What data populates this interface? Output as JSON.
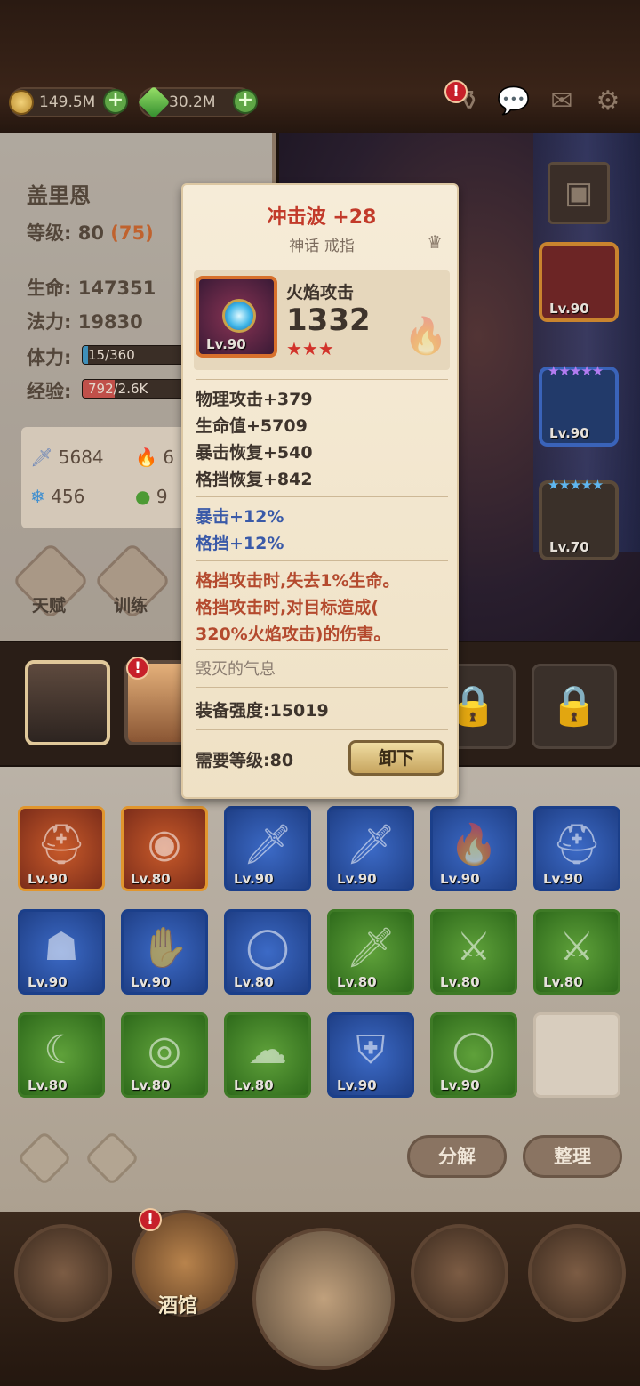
{
  "top": {
    "gold": "149.5M",
    "gems": "30.2M",
    "alert_mark": "!"
  },
  "hero": {
    "name": "盖里恩",
    "level_label": "等级:",
    "level": "80",
    "level_extra": "(75)",
    "hp_label": "生命:",
    "hp": "147351",
    "mp_label": "法力:",
    "mp": "19830",
    "stamina_label": "体力:",
    "stamina": "15/360",
    "stamina_fraction": 0.042,
    "exp_label": "经验:",
    "exp": "792/2.6K",
    "exp_fraction": 0.3,
    "attack": "5684",
    "attack_partial": "6",
    "defense": "456",
    "defense_partial": "9",
    "btn_talent": "天赋",
    "btn_train": "训练"
  },
  "scene_slots": [
    {
      "level": "Lv.90"
    },
    {
      "level": "Lv.90"
    },
    {
      "level": "Lv.70"
    }
  ],
  "tooltip": {
    "title": "冲击波 +28",
    "subtitle": "神话 戒指",
    "attr_name": "火焰攻击",
    "attr_value": "1332",
    "item_level": "Lv.90",
    "stars": "★★★",
    "stats": [
      "物理攻击+379",
      "生命值+5709",
      "暴击恢复+540",
      "格挡恢复+842"
    ],
    "bonuses": [
      "暴击+12%",
      "格挡+12%"
    ],
    "effect": [
      "格挡攻击时,失去1%生命。",
      "格挡攻击时,对目标造成(",
      "320%火焰攻击)的伤害。"
    ],
    "set_name": "毁灭的气息",
    "power_label": "装备强度:",
    "power": "15019",
    "req_label": "需要等级:",
    "req_level": "80",
    "unequip_label": "卸下"
  },
  "inventory": [
    [
      {
        "lv": "Lv.90",
        "type": "gold",
        "icon": "helmet-icon"
      },
      {
        "lv": "Lv.80",
        "type": "gold",
        "icon": "amulet-icon"
      },
      {
        "lv": "Lv.90",
        "type": "blue",
        "icon": "sword-icon"
      },
      {
        "lv": "Lv.90",
        "type": "blue",
        "icon": "dagger-icon"
      },
      {
        "lv": "Lv.90",
        "type": "blue",
        "icon": "fire-orb-icon"
      },
      {
        "lv": "Lv.90",
        "type": "blue",
        "icon": "helmet-icon"
      }
    ],
    [
      {
        "lv": "Lv.90",
        "type": "blue",
        "icon": "hood-icon"
      },
      {
        "lv": "Lv.90",
        "type": "blue",
        "icon": "gauntlet-icon"
      },
      {
        "lv": "Lv.80",
        "type": "blue",
        "icon": "ring-icon"
      },
      {
        "lv": "Lv.80",
        "type": "green",
        "icon": "sword-icon"
      },
      {
        "lv": "Lv.80",
        "type": "green",
        "icon": "scimitar-icon"
      },
      {
        "lv": "Lv.80",
        "type": "green",
        "icon": "scimitar-icon"
      }
    ],
    [
      {
        "lv": "Lv.80",
        "type": "green",
        "icon": "tooth-necklace-icon"
      },
      {
        "lv": "Lv.80",
        "type": "green",
        "icon": "necklace-icon"
      },
      {
        "lv": "Lv.80",
        "type": "green",
        "icon": "cloak-icon"
      },
      {
        "lv": "Lv.90",
        "type": "blue",
        "icon": "shield-icon"
      },
      {
        "lv": "Lv.90",
        "type": "green",
        "icon": "ring-icon"
      },
      {
        "lv": "",
        "type": "empty",
        "icon": ""
      }
    ]
  ],
  "actions": {
    "decompose": "分解",
    "sort": "整理"
  },
  "nav": {
    "tavern": "酒馆"
  }
}
